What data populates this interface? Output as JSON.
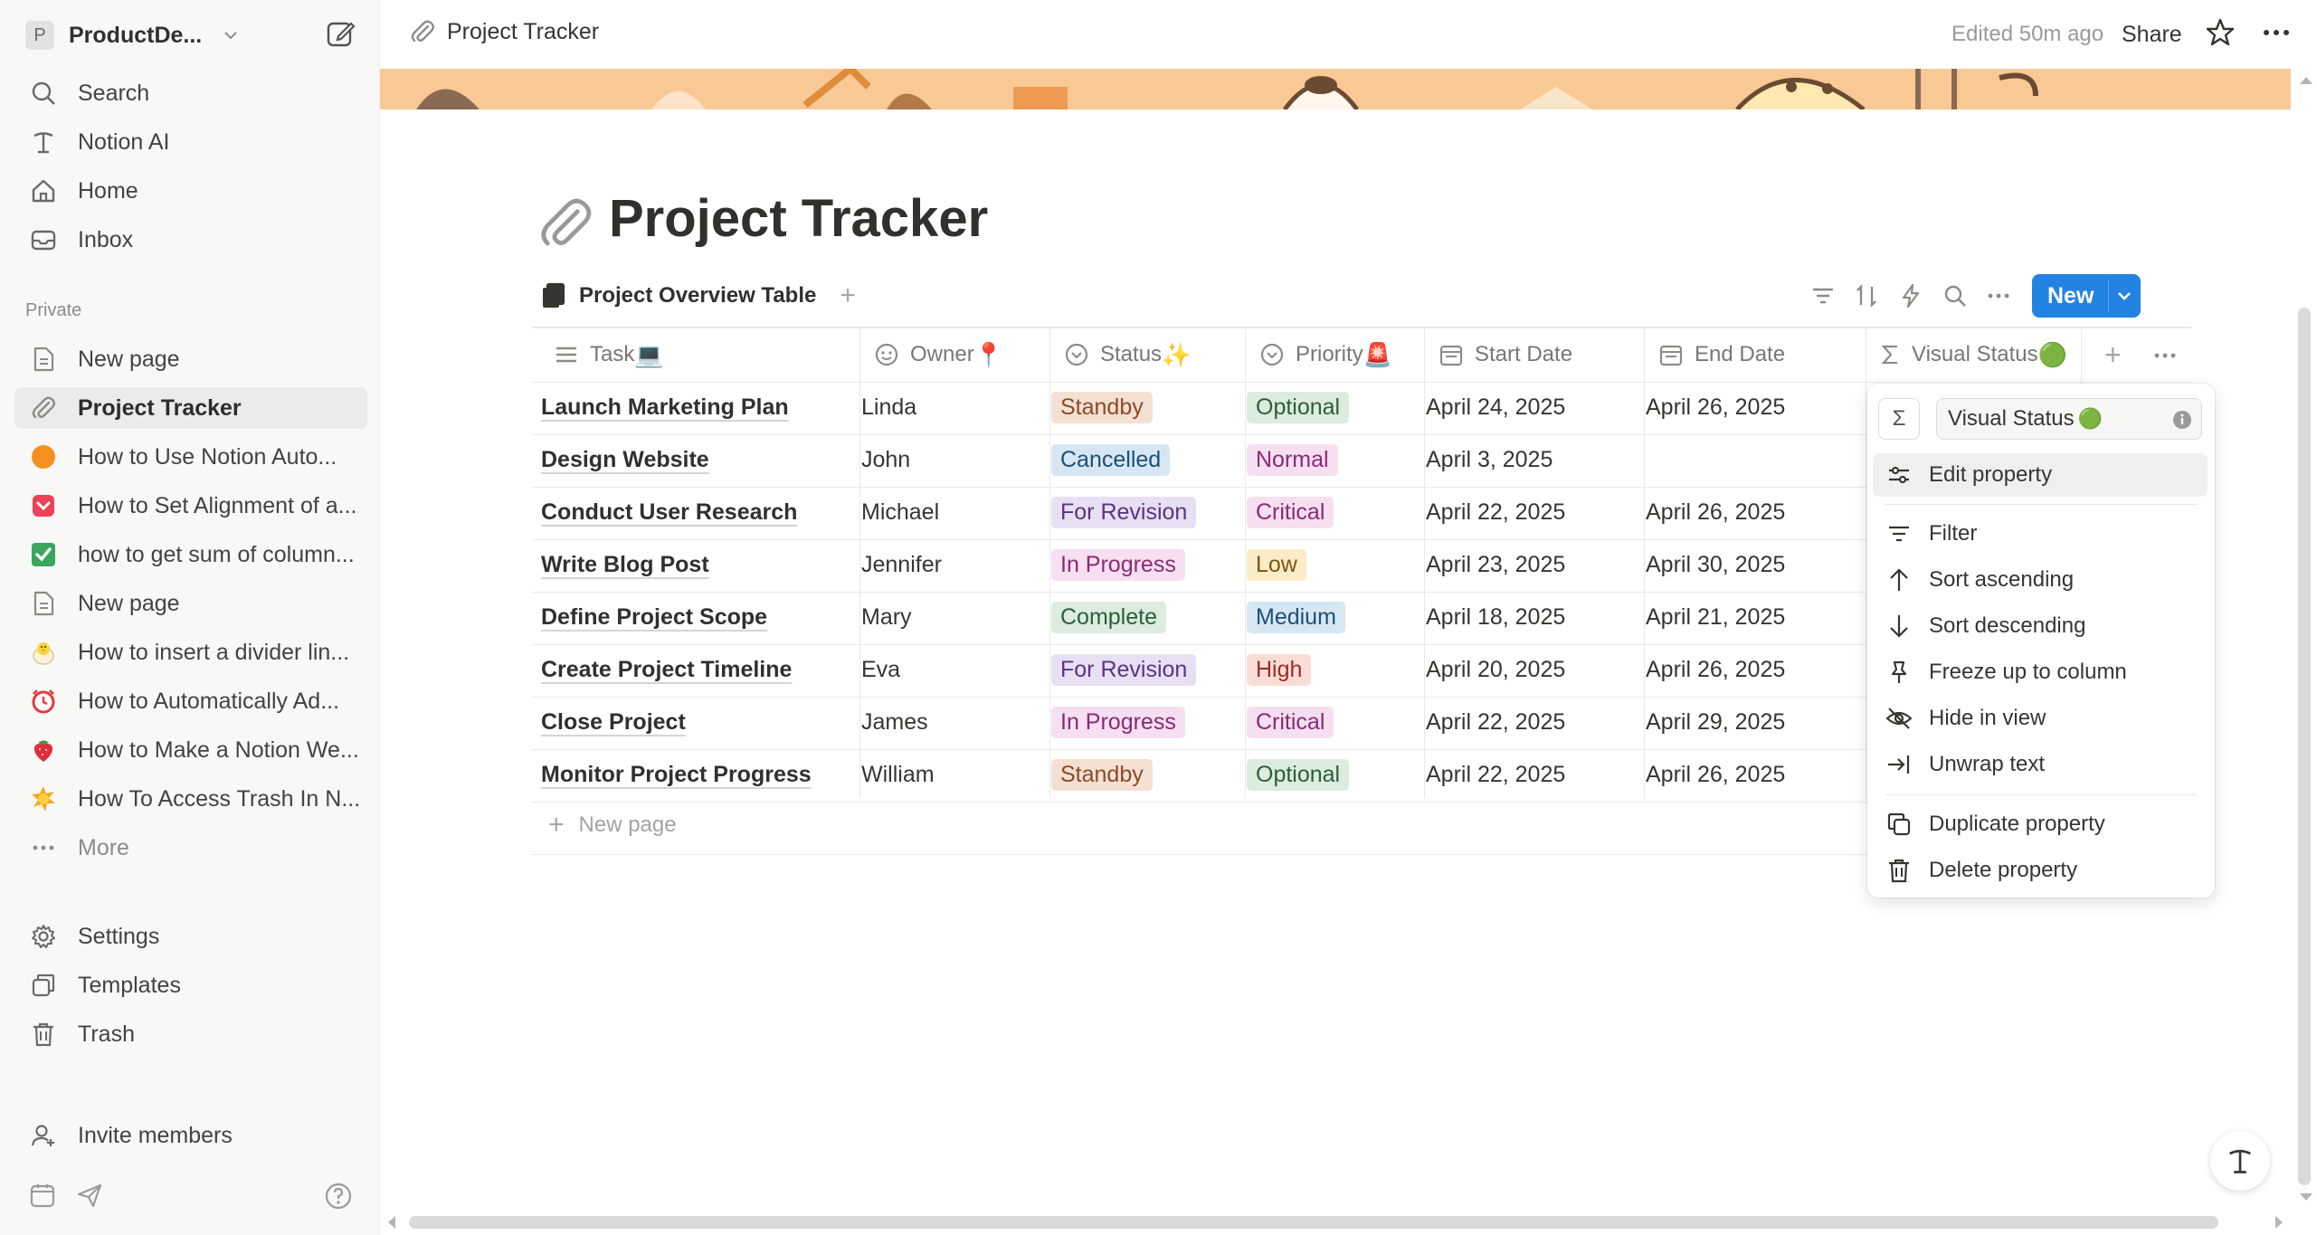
{
  "sidebar": {
    "workspace": {
      "avatar_letter": "P",
      "name": "ProductDe..."
    },
    "top_nav": [
      {
        "label": "Search",
        "icon": "search-icon"
      },
      {
        "label": "Notion AI",
        "icon": "notion-ai-icon"
      },
      {
        "label": "Home",
        "icon": "home-icon"
      },
      {
        "label": "Inbox",
        "icon": "inbox-icon"
      }
    ],
    "section_title": "Private",
    "pages": [
      {
        "label": "New page",
        "icon": "page-icon"
      },
      {
        "label": "Project Tracker",
        "icon": "paperclip-icon",
        "active": true
      },
      {
        "label": "How to Use Notion Auto...",
        "icon": "orange-circle-icon"
      },
      {
        "label": "How to Set Alignment of a...",
        "icon": "pocket-icon"
      },
      {
        "label": "how to get sum of column...",
        "icon": "checkmark-box-icon"
      },
      {
        "label": "New page",
        "icon": "page-icon"
      },
      {
        "label": "How to insert a divider lin...",
        "icon": "chick-icon"
      },
      {
        "label": "How to Automatically Ad...",
        "icon": "alarm-clock-icon"
      },
      {
        "label": "How to Make a Notion We...",
        "icon": "strawberry-icon"
      },
      {
        "label": "How To Access Trash In N...",
        "icon": "sun-icon"
      }
    ],
    "more_label": "More",
    "bottom_nav": [
      {
        "label": "Settings",
        "icon": "gear-icon"
      },
      {
        "label": "Templates",
        "icon": "templates-icon"
      },
      {
        "label": "Trash",
        "icon": "trash-icon"
      }
    ],
    "invite_label": "Invite members"
  },
  "topbar": {
    "breadcrumb": "Project Tracker",
    "edited": "Edited 50m ago",
    "share": "Share"
  },
  "page": {
    "title": "Project Tracker",
    "view_tab": "Project Overview Table",
    "new_button": "New",
    "new_page_row": "New page"
  },
  "table": {
    "columns": [
      {
        "label": "Task",
        "emoji": "💻"
      },
      {
        "label": "Owner",
        "emoji": "📍"
      },
      {
        "label": "Status",
        "emoji": "✨"
      },
      {
        "label": "Priority",
        "emoji": "🚨"
      },
      {
        "label": "Start Date",
        "emoji": ""
      },
      {
        "label": "End Date",
        "emoji": ""
      },
      {
        "label": "Visual Status",
        "emoji": "🟢"
      }
    ],
    "rows": [
      {
        "task": "Launch Marketing Plan",
        "owner": "Linda",
        "status": "Standby",
        "priority": "Optional",
        "start": "April 24, 2025",
        "end": "April 26, 2025"
      },
      {
        "task": "Design Website",
        "owner": "John",
        "status": "Cancelled",
        "priority": "Normal",
        "start": "April 3, 2025",
        "end": ""
      },
      {
        "task": "Conduct User Research",
        "owner": "Michael",
        "status": "For Revision",
        "priority": "Critical",
        "start": "April 22, 2025",
        "end": "April 26, 2025"
      },
      {
        "task": "Write Blog Post",
        "owner": "Jennifer",
        "status": "In Progress",
        "priority": "Low",
        "start": "April 23, 2025",
        "end": "April 30, 2025"
      },
      {
        "task": "Define Project Scope",
        "owner": "Mary",
        "status": "Complete",
        "priority": "Medium",
        "start": "April 18, 2025",
        "end": "April 21, 2025"
      },
      {
        "task": "Create Project Timeline",
        "owner": "Eva",
        "status": "For Revision",
        "priority": "High",
        "start": "April 20, 2025",
        "end": "April 26, 2025"
      },
      {
        "task": "Close Project",
        "owner": "James",
        "status": "In Progress",
        "priority": "Critical",
        "start": "April 22, 2025",
        "end": "April 29, 2025"
      },
      {
        "task": "Monitor Project Progress",
        "owner": "William",
        "status": "Standby",
        "priority": "Optional",
        "start": "April 22, 2025",
        "end": "April 26, 2025"
      }
    ],
    "tag_colors": {
      "Standby": {
        "bg": "#f4e0d3",
        "fg": "#8c4a24"
      },
      "Cancelled": {
        "bg": "#d6e7f3",
        "fg": "#1d4f76"
      },
      "For Revision": {
        "bg": "#e9dff3",
        "fg": "#5a3387"
      },
      "In Progress": {
        "bg": "#f6dff0",
        "fg": "#8a2b74"
      },
      "Complete": {
        "bg": "#dcecdf",
        "fg": "#2c5e37"
      },
      "Optional": {
        "bg": "#dcecdf",
        "fg": "#2c5e37"
      },
      "Normal": {
        "bg": "#f6dff0",
        "fg": "#8a2b74"
      },
      "Critical": {
        "bg": "#f6dff0",
        "fg": "#8a2b74"
      },
      "Low": {
        "bg": "#fbecc8",
        "fg": "#7c5511"
      },
      "Medium": {
        "bg": "#d6e7f3",
        "fg": "#1d4f76"
      },
      "High": {
        "bg": "#fadcd7",
        "fg": "#9b2d23"
      }
    }
  },
  "property_menu": {
    "property_name": "Visual Status",
    "property_emoji": "🟢",
    "items": [
      {
        "label": "Edit property",
        "icon": "sliders-icon"
      },
      {
        "label": "Filter",
        "icon": "filter-icon"
      },
      {
        "label": "Sort ascending",
        "icon": "arrow-up-icon"
      },
      {
        "label": "Sort descending",
        "icon": "arrow-down-icon"
      },
      {
        "label": "Freeze up to column",
        "icon": "pin-icon"
      },
      {
        "label": "Hide in view",
        "icon": "eye-off-icon"
      },
      {
        "label": "Unwrap text",
        "icon": "unwrap-icon"
      },
      {
        "label": "Duplicate property",
        "icon": "duplicate-icon"
      },
      {
        "label": "Delete property",
        "icon": "trash-icon"
      }
    ]
  },
  "colors": {
    "accent": "#2383e2",
    "sidebar_bg": "#f8f8f7",
    "cover": "#f9c995"
  }
}
